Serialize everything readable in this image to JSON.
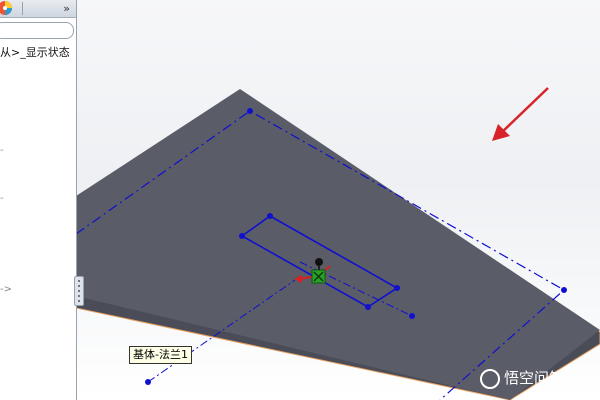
{
  "feature_tree": {
    "tree_text": "从>_显示状态",
    "expand_chevrons": "»",
    "markers": [
      "-",
      "-",
      "->"
    ]
  },
  "viewport": {
    "callout_label": "基体-法兰1",
    "arrow_color": "#d8232a"
  },
  "watermark": {
    "text": "悟空问答"
  },
  "colors": {
    "plate_face": "#5a5c68",
    "plate_edge": "#e8a060",
    "sketch_line": "#1010d0",
    "origin_x": "#d82020",
    "origin_y": "#20a020"
  },
  "icons": [
    "color-wheel-icon",
    "chevron-right-double-icon",
    "origin-icon",
    "red-arrow-icon"
  ]
}
